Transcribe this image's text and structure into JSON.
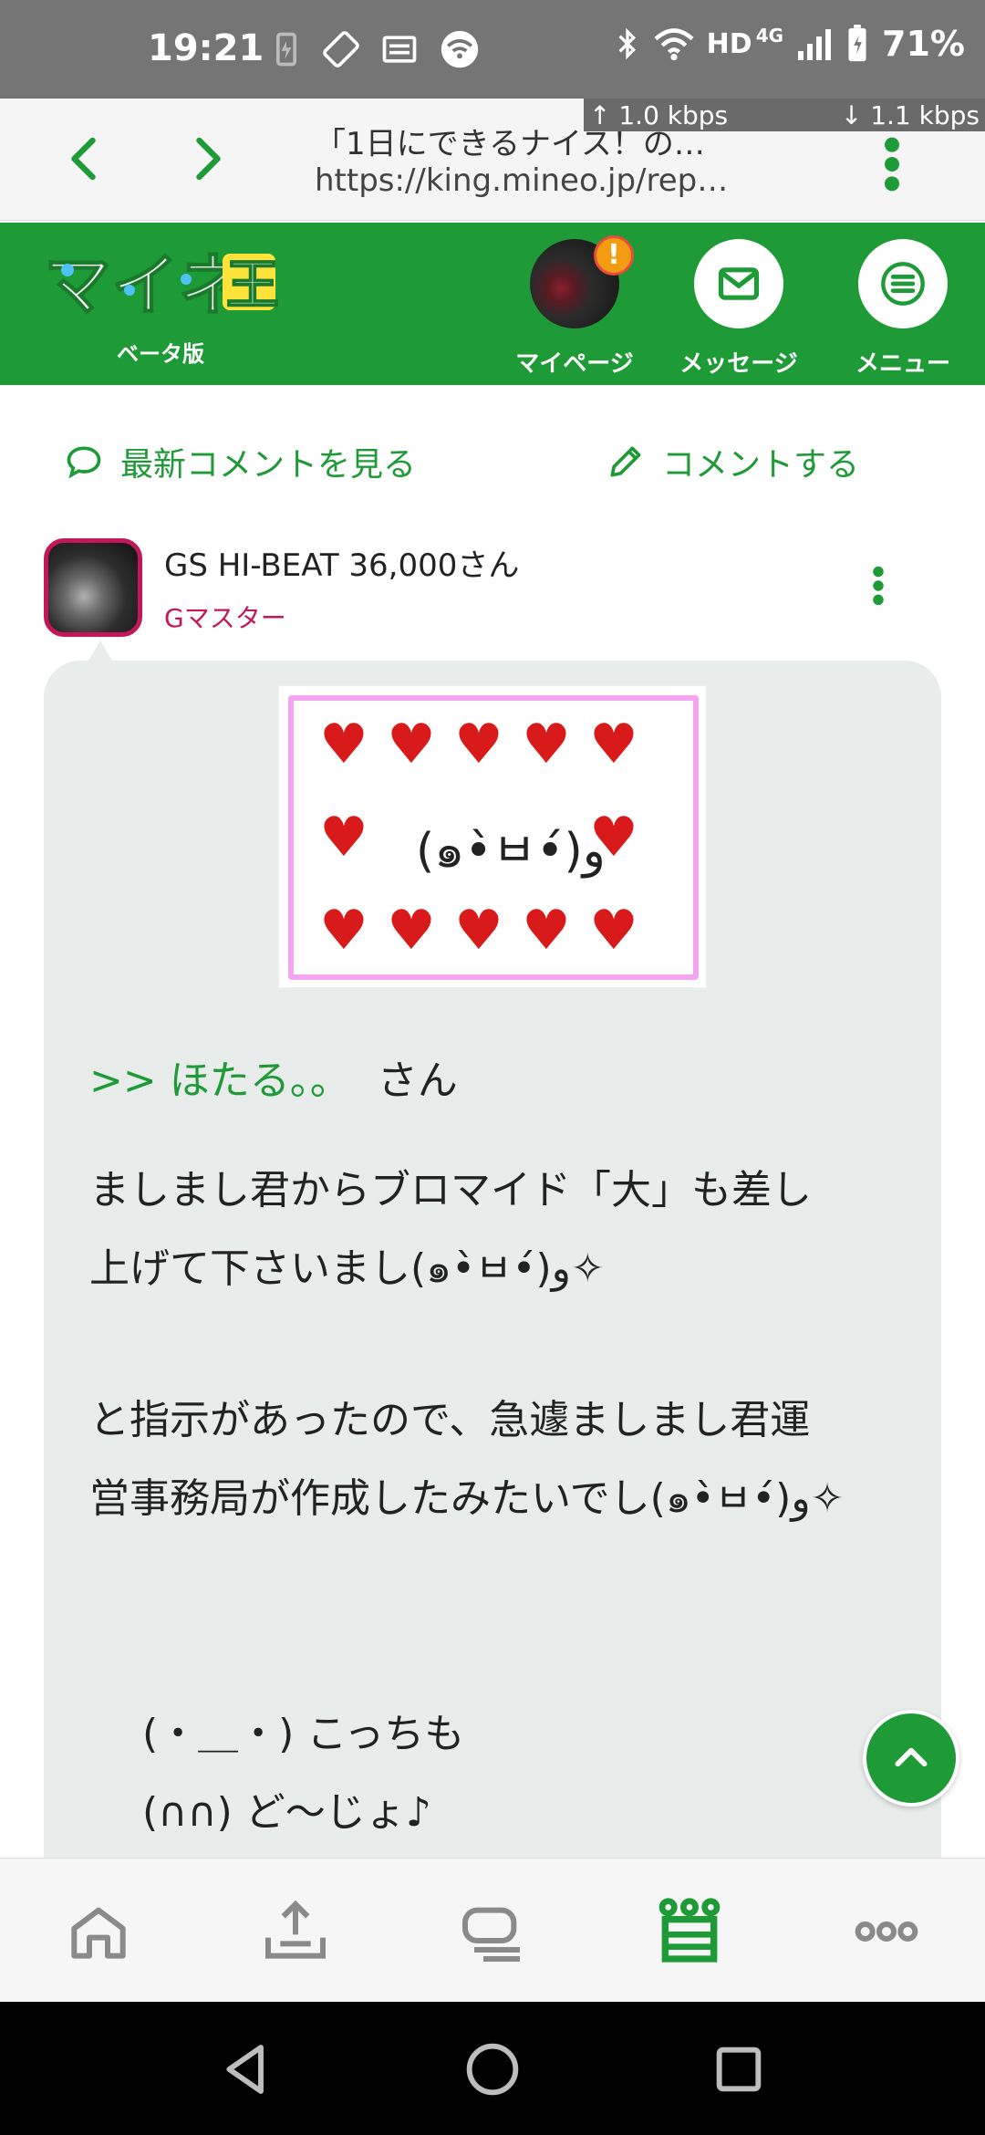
{
  "status_bar": {
    "time": "19:21",
    "network_label": "HD",
    "network_type": "4G",
    "battery": "71%",
    "upload_speed": "↑ 1.0 kbps",
    "download_speed": "↓ 1.1 kbps"
  },
  "browser": {
    "page_title": "「1日にできるナイス！の…",
    "url": "https://king.mineo.jp/rep…"
  },
  "header": {
    "logo_text": "マイネ王",
    "beta_label": "ベータ版",
    "mypage_label": "マイページ",
    "message_label": "メッセージ",
    "menu_label": "メニュー",
    "alert_badge": "!"
  },
  "actions": {
    "latest_comments": "最新コメントを見る",
    "write_comment": "コメントする"
  },
  "post": {
    "user_name": "GS HI-BEAT 36,000さん",
    "user_rank": "Gマスター",
    "stamp_kaomoji": "(๑•̀ㅂ•́)و",
    "reply_to": ">> ほたる。。",
    "reply_suffix": "さん",
    "paragraph_1_line_1": "ましまし君からブロマイド「大」も差し",
    "paragraph_1_line_2": "上げて下さいまし(๑•̀ㅂ•́)و✧",
    "paragraph_2_line_1": "と指示があったので、急遽ましまし君運",
    "paragraph_2_line_2": "営事務局が作成したみたいでし(๑•̀ㅂ•́)و✧",
    "line_3": "(・＿・) こっちも",
    "line_4": "(∩∩) ど〜じょ♪"
  },
  "colors": {
    "brand_green": "#1e9a37",
    "rank_pink": "#c2185b",
    "bubble_bg": "#e8ecea",
    "heart_red": "#d91a1a"
  },
  "icons": {
    "back": "chevron-left-icon",
    "forward": "chevron-right-icon",
    "more": "kebab-icon",
    "mail": "mail-icon",
    "menu": "hamburger-icon",
    "comment": "speech-bubble-icon",
    "pencil": "pencil-icon",
    "scroll_top": "chevron-up-icon",
    "tab_home": "home-icon",
    "tab_upload": "upload-icon",
    "tab_board": "board-icon",
    "tab_king": "crown-icon",
    "tab_more": "more-icon"
  }
}
